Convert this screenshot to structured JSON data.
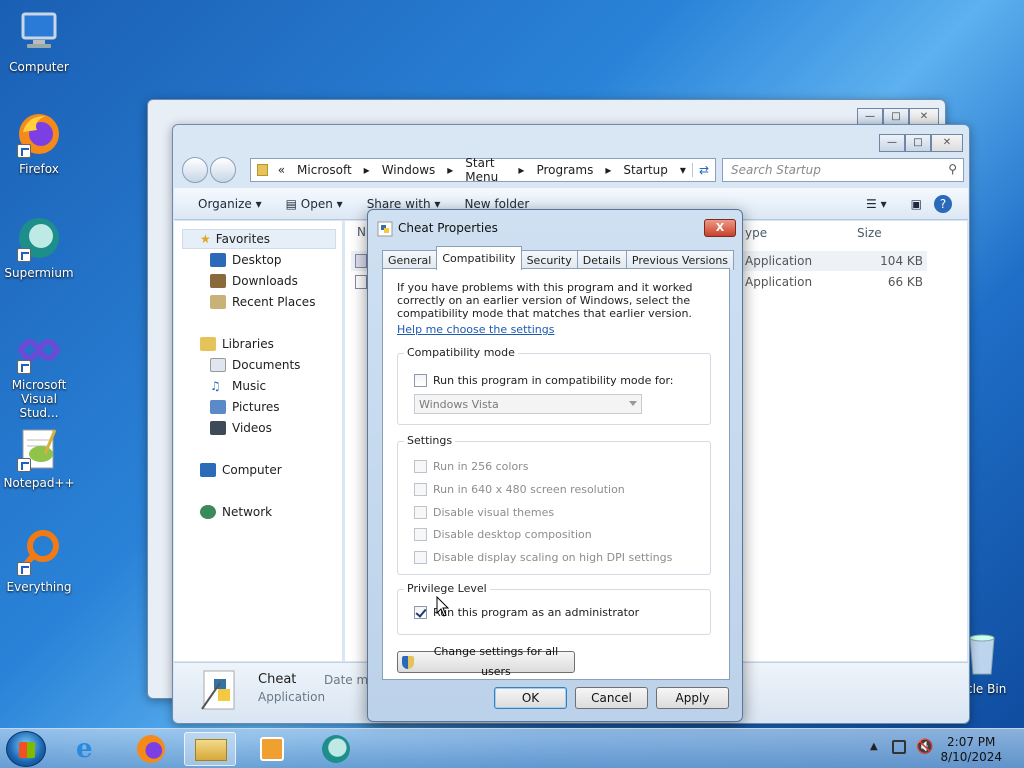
{
  "desktop": {
    "icons": [
      {
        "name": "computer",
        "label": "Computer"
      },
      {
        "name": "firefox",
        "label": "Firefox"
      },
      {
        "name": "supermium",
        "label": "Supermium"
      },
      {
        "name": "visual-studio",
        "label": "Microsoft Visual Stud..."
      },
      {
        "name": "notepadpp",
        "label": "Notepad++"
      },
      {
        "name": "everything",
        "label": "Everything"
      },
      {
        "name": "recycle-bin",
        "label": "cle Bin"
      }
    ]
  },
  "explorer": {
    "address_crumbs": [
      "Microsoft",
      "Windows",
      "Start Menu",
      "Programs",
      "Startup"
    ],
    "address_prefix": "«",
    "search_placeholder": "Search Startup",
    "toolbar": {
      "organize": "Organize",
      "open": "Open",
      "share_with": "Share with",
      "new_folder": "New folder"
    },
    "nav": {
      "favorites": "Favorites",
      "desktop": "Desktop",
      "downloads": "Downloads",
      "recent_places": "Recent Places",
      "libraries": "Libraries",
      "documents": "Documents",
      "music": "Music",
      "pictures": "Pictures",
      "videos": "Videos",
      "computer": "Computer",
      "network": "Network"
    },
    "columns": {
      "name": "N",
      "type": "ype",
      "size": "Size"
    },
    "rows": [
      {
        "type": "Application",
        "size": "104 KB"
      },
      {
        "type": "Application",
        "size": "66 KB"
      }
    ],
    "details": {
      "name": "Cheat",
      "type": "Application",
      "date_label": "Date mo"
    }
  },
  "dialog": {
    "title": "Cheat Properties",
    "close": "X",
    "tabs": [
      "General",
      "Compatibility",
      "Security",
      "Details",
      "Previous Versions"
    ],
    "active_tab": "Compatibility",
    "intro": "If you have problems with this program and it worked correctly on an earlier version of Windows, select the compatibility mode that matches that earlier version.",
    "help_link": "Help me choose the settings",
    "compat_group": "Compatibility mode",
    "compat_checkbox": "Run this program in compatibility mode for:",
    "compat_select": "Windows Vista",
    "settings_group": "Settings",
    "settings": [
      "Run in 256 colors",
      "Run in 640 x 480 screen resolution",
      "Disable visual themes",
      "Disable desktop composition",
      "Disable display scaling on high DPI settings"
    ],
    "privilege_group": "Privilege Level",
    "privilege_checkbox": "Run this program as an administrator",
    "privilege_checked": true,
    "change_all_users": "Change settings for all users",
    "ok": "OK",
    "cancel": "Cancel",
    "apply": "Apply"
  },
  "taskbar": {
    "time": "2:07 PM",
    "date": "8/10/2024"
  }
}
